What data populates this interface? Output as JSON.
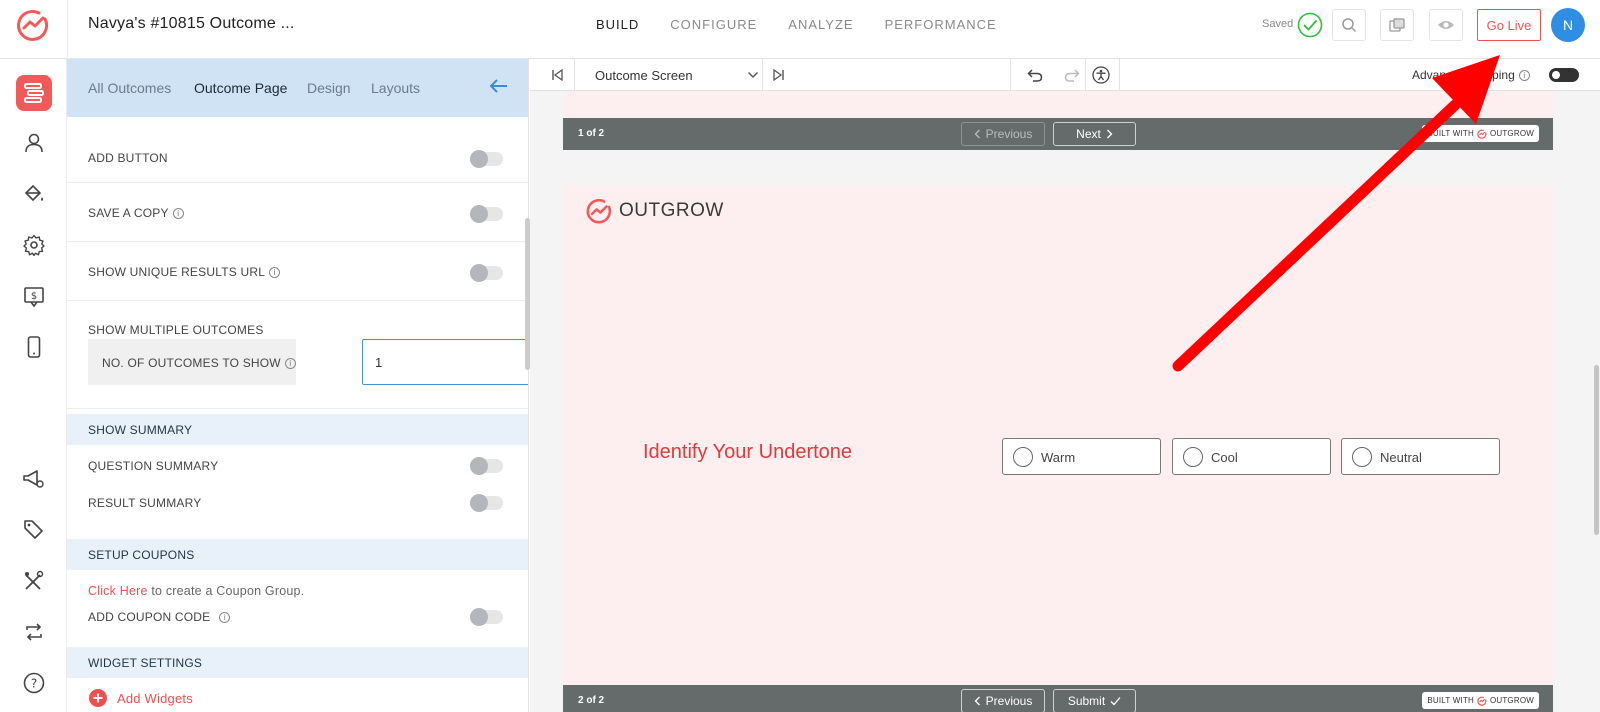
{
  "app": {
    "title": "Navya's #10815 Outcome ...",
    "tabs": [
      "BUILD",
      "CONFIGURE",
      "ANALYZE",
      "PERFORMANCE"
    ],
    "active_tab": "BUILD",
    "saved_label": "Saved",
    "go_live_label": "Go Live",
    "avatar_initial": "N",
    "brand_color": "#f25a5a"
  },
  "rail": {
    "icons": [
      "content-icon",
      "user-icon",
      "paint-bucket-icon",
      "gear-icon",
      "pricing-icon",
      "mobile-icon",
      "promote-icon",
      "tag-icon",
      "tools-icon",
      "sync-icon",
      "help-icon"
    ],
    "active": "content-icon"
  },
  "panel": {
    "tabs": [
      "All Outcomes",
      "Outcome Page",
      "Design",
      "Layouts"
    ],
    "active_tab": "Outcome Page",
    "rows": {
      "add_button": "ADD BUTTON",
      "save_copy": "SAVE A COPY",
      "unique_url": "SHOW UNIQUE RESULTS URL",
      "multiple_outcomes": "SHOW MULTIPLE OUTCOMES",
      "no_outcomes": "NO. OF OUTCOMES TO SHOW",
      "no_outcomes_value": "1",
      "show_summary": "SHOW SUMMARY",
      "question_summary": "QUESTION SUMMARY",
      "result_summary": "RESULT SUMMARY",
      "setup_coupons": "SETUP COUPONS",
      "click_here": "Click Here",
      "coupon_text": " to create a Coupon Group.",
      "add_coupon": "ADD COUPON CODE",
      "widget_settings": "WIDGET SETTINGS",
      "add_widgets": "Add Widgets"
    }
  },
  "canvas": {
    "screen_select": "Outcome Screen",
    "advanced_label": "Advanced Mapping",
    "top_bar": {
      "page": "1 of 2",
      "previous": "Previous",
      "next": "Next",
      "built_with": "BUILT WITH",
      "brand": "OUTGROW"
    },
    "brand_name": "OUTGROW",
    "question": "Identify Your Undertone",
    "options": [
      "Warm",
      "Cool",
      "Neutral"
    ],
    "bottom_bar": {
      "page": "2 of 2",
      "previous": "Previous",
      "submit": "Submit",
      "built_with": "BUILT WITH",
      "brand": "OUTGROW"
    }
  }
}
